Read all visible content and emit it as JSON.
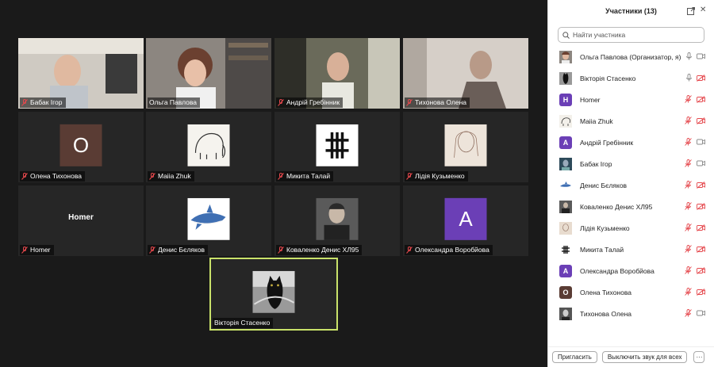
{
  "colors": {
    "accent": "#c9e26a",
    "muted_red": "#e5484d",
    "avatar_purple": "#6b3fb6",
    "avatar_brown": "#5a3c34"
  },
  "tiles": [
    {
      "name": "Бабак Ігор",
      "muted": true,
      "kind": "video"
    },
    {
      "name": "Ольга Павлова",
      "muted": false,
      "kind": "video"
    },
    {
      "name": "Андрій Гребінник",
      "muted": true,
      "kind": "video"
    },
    {
      "name": "Тихонова Олена",
      "muted": true,
      "kind": "video"
    },
    {
      "name": "Олена Тихонова",
      "muted": true,
      "kind": "letter",
      "letter": "О"
    },
    {
      "name": "Maiia Zhuk",
      "muted": true,
      "kind": "image",
      "icon": "mammoth-icon"
    },
    {
      "name": "Микита Талай",
      "muted": true,
      "kind": "image",
      "icon": "hash-icon"
    },
    {
      "name": "Лідія Кузьменко",
      "muted": true,
      "kind": "image",
      "icon": "sketch-portrait-icon"
    },
    {
      "name": "Homer",
      "muted": true,
      "kind": "name_only"
    },
    {
      "name": "Денис Бєляков",
      "muted": true,
      "kind": "image",
      "icon": "shark-icon"
    },
    {
      "name": "Коваленко Денис ХЛ95",
      "muted": true,
      "kind": "image",
      "icon": "portrait-icon"
    },
    {
      "name": "Олександра Воробйова",
      "muted": true,
      "kind": "letter",
      "letter": "A"
    },
    {
      "name": "Вікторія Стасенко",
      "muted": false,
      "kind": "image",
      "icon": "cat-icon",
      "active": true
    }
  ],
  "panel": {
    "title": "Участники (13)",
    "search_placeholder": "Найти участника",
    "participants": [
      {
        "name": "Ольга Павлова (Организатор, я)",
        "av": "photo",
        "mic": "on",
        "cam": "on"
      },
      {
        "name": "Вікторія Стасенко",
        "av": "cat",
        "mic": "on",
        "cam": "off"
      },
      {
        "name": "Homer",
        "av": "letter",
        "letter": "H",
        "mic": "off",
        "cam": "off"
      },
      {
        "name": "Maiia Zhuk",
        "av": "mammoth",
        "mic": "off",
        "cam": "off"
      },
      {
        "name": "Андрій Гребінник",
        "av": "letter",
        "letter": "A",
        "mic": "off",
        "cam": "on"
      },
      {
        "name": "Бабак Ігор",
        "av": "photo2",
        "mic": "off",
        "cam": "on"
      },
      {
        "name": "Денис Бєляков",
        "av": "shark",
        "mic": "off",
        "cam": "off"
      },
      {
        "name": "Коваленко Денис ХЛ95",
        "av": "portrait",
        "mic": "off",
        "cam": "off"
      },
      {
        "name": "Лідія Кузьменко",
        "av": "sketch",
        "mic": "off",
        "cam": "off"
      },
      {
        "name": "Микита Талай",
        "av": "hash",
        "mic": "off",
        "cam": "off"
      },
      {
        "name": "Олександра Воробйова",
        "av": "letter",
        "letter": "A",
        "mic": "off",
        "cam": "off"
      },
      {
        "name": "Олена Тихонова",
        "av": "letter_brown",
        "letter": "О",
        "mic": "off",
        "cam": "off"
      },
      {
        "name": "Тихонова Олена",
        "av": "photo3",
        "mic": "off",
        "cam": "on"
      }
    ],
    "invite_label": "Пригласить",
    "mute_all_label": "Выключить звук для всех",
    "more_label": "···"
  }
}
